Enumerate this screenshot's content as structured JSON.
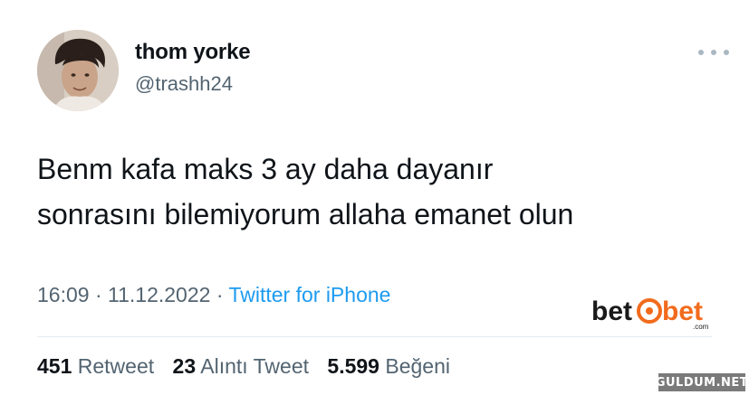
{
  "author": {
    "display_name": "thom yorke",
    "handle": "@trashh24"
  },
  "tweet": {
    "text_lines": [
      "Benm kafa maks 3 ay daha dayanır",
      "sonrasını bilemiyorum allaha emanet olun"
    ],
    "time": "16:09",
    "separator": "·",
    "date": "11.12.2022",
    "source": "Twitter for iPhone"
  },
  "stats": {
    "retweets_count": "451",
    "retweets_label": "Retweet",
    "quotes_count": "23",
    "quotes_label": "Alıntı Tweet",
    "likes_count": "5.599",
    "likes_label": "Beğeni"
  },
  "watermarks": {
    "betebet": "bet@bet .com",
    "guldum": "GULDUM.NET"
  },
  "icons": {
    "more": "more-horizontal-icon",
    "avatar": "profile-avatar"
  },
  "colors": {
    "text_primary": "#0f1419",
    "text_secondary": "#536471",
    "link_blue": "#1d9bf0",
    "divider": "#e6ecf0",
    "betebet_orange": "#f26b1d",
    "betebet_dark": "#1a1a1a"
  }
}
